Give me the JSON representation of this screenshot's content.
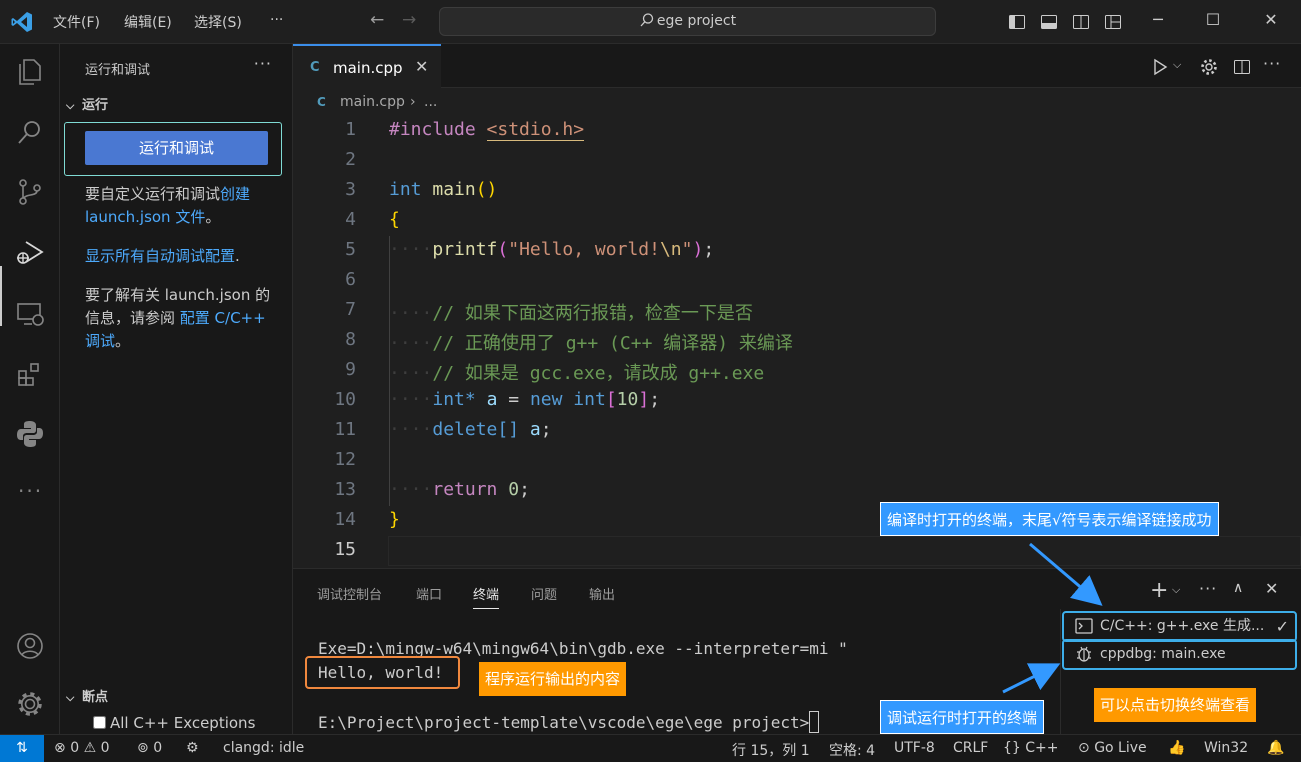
{
  "titlebar": {
    "menu": [
      "文件(F)",
      "编辑(E)",
      "选择(S)",
      "···"
    ],
    "search": "ege project"
  },
  "sidebar": {
    "title": "运行和调试",
    "more": "···",
    "run_section": "运行",
    "run_button": "运行和调试",
    "text1_a": "要自定义运行和调试",
    "text1_link": "创建 launch.json 文件",
    "text1_b": "。",
    "text2_link": "显示所有自动调试配置",
    "text2_b": ".",
    "text3_a": "要了解有关 launch.json 的信息，请参阅 ",
    "text3_link": "配置 C/C++ 调试",
    "text3_b": "。",
    "breakpoints_section": "断点",
    "breakpoint_item": "All C++ Exceptions"
  },
  "editor": {
    "tab": "main.cpp",
    "tab_icon": "C",
    "breadcrumb_file": "main.cpp",
    "breadcrumb_more": "...",
    "line_numbers": [
      "1",
      "2",
      "3",
      "4",
      "5",
      "6",
      "7",
      "8",
      "9",
      "10",
      "11",
      "12",
      "13",
      "14",
      "15"
    ],
    "code": {
      "l1_pp": "#include",
      "l1_inc": "<stdio.h>",
      "l3_type": "int",
      "l3_fn": "main",
      "l3_paren": "()",
      "l4": "{",
      "l5_fn": "printf",
      "l5_str": "\"Hello, world!",
      "l5_esc": "\\n",
      "l5_end": "\"",
      "l7": "// 如果下面这两行报错，检查一下是否",
      "l8": "// 正确使用了 g++ (C++ 编译器) 来编译",
      "l9": "// 如果是 gcc.exe，请改成 g++.exe",
      "l10_type": "int*",
      "l10_var": "a",
      "l10_op": "=",
      "l10_kw": "new",
      "l10_type2": "int",
      "l10_num": "10",
      "l11_kw": "delete[]",
      "l11_var": "a",
      "l13_kw": "return",
      "l13_num": "0",
      "l14": "}"
    }
  },
  "panel": {
    "tabs": [
      "调试控制台",
      "端口",
      "终端",
      "问题",
      "输出"
    ],
    "active_tab": "终端",
    "term_line1": "Exe=D:\\mingw-w64\\mingw64\\bin\\gdb.exe --interpreter=mi \"",
    "term_line2": "Hello, world!",
    "term_line3": "E:\\Project\\project-template\\vscode\\ege\\ege project>",
    "terminals": [
      "C/C++: g++.exe 生成...",
      "cppdbg: main.exe"
    ]
  },
  "annotations": {
    "compile_terminal": "编译时打开的终端，末尾√符号表示编译链接成功",
    "program_output": "程序运行输出的内容",
    "debug_terminal": "调试运行时打开的终端",
    "switch_hint": "可以点击切换终端查看"
  },
  "statusbar": {
    "errors": "0",
    "warnings": "0",
    "ports": "0",
    "clangd": "clangd: idle",
    "position": "行 15，列 1",
    "spaces": "空格: 4",
    "encoding": "UTF-8",
    "eol": "CRLF",
    "language": "C++",
    "golive": "Go Live",
    "platform": "Win32"
  },
  "colors": {
    "accent": "#0078d4",
    "annotation_blue": "#3399ff",
    "annotation_orange": "#ff9900",
    "run_button": "#4a78d2"
  }
}
